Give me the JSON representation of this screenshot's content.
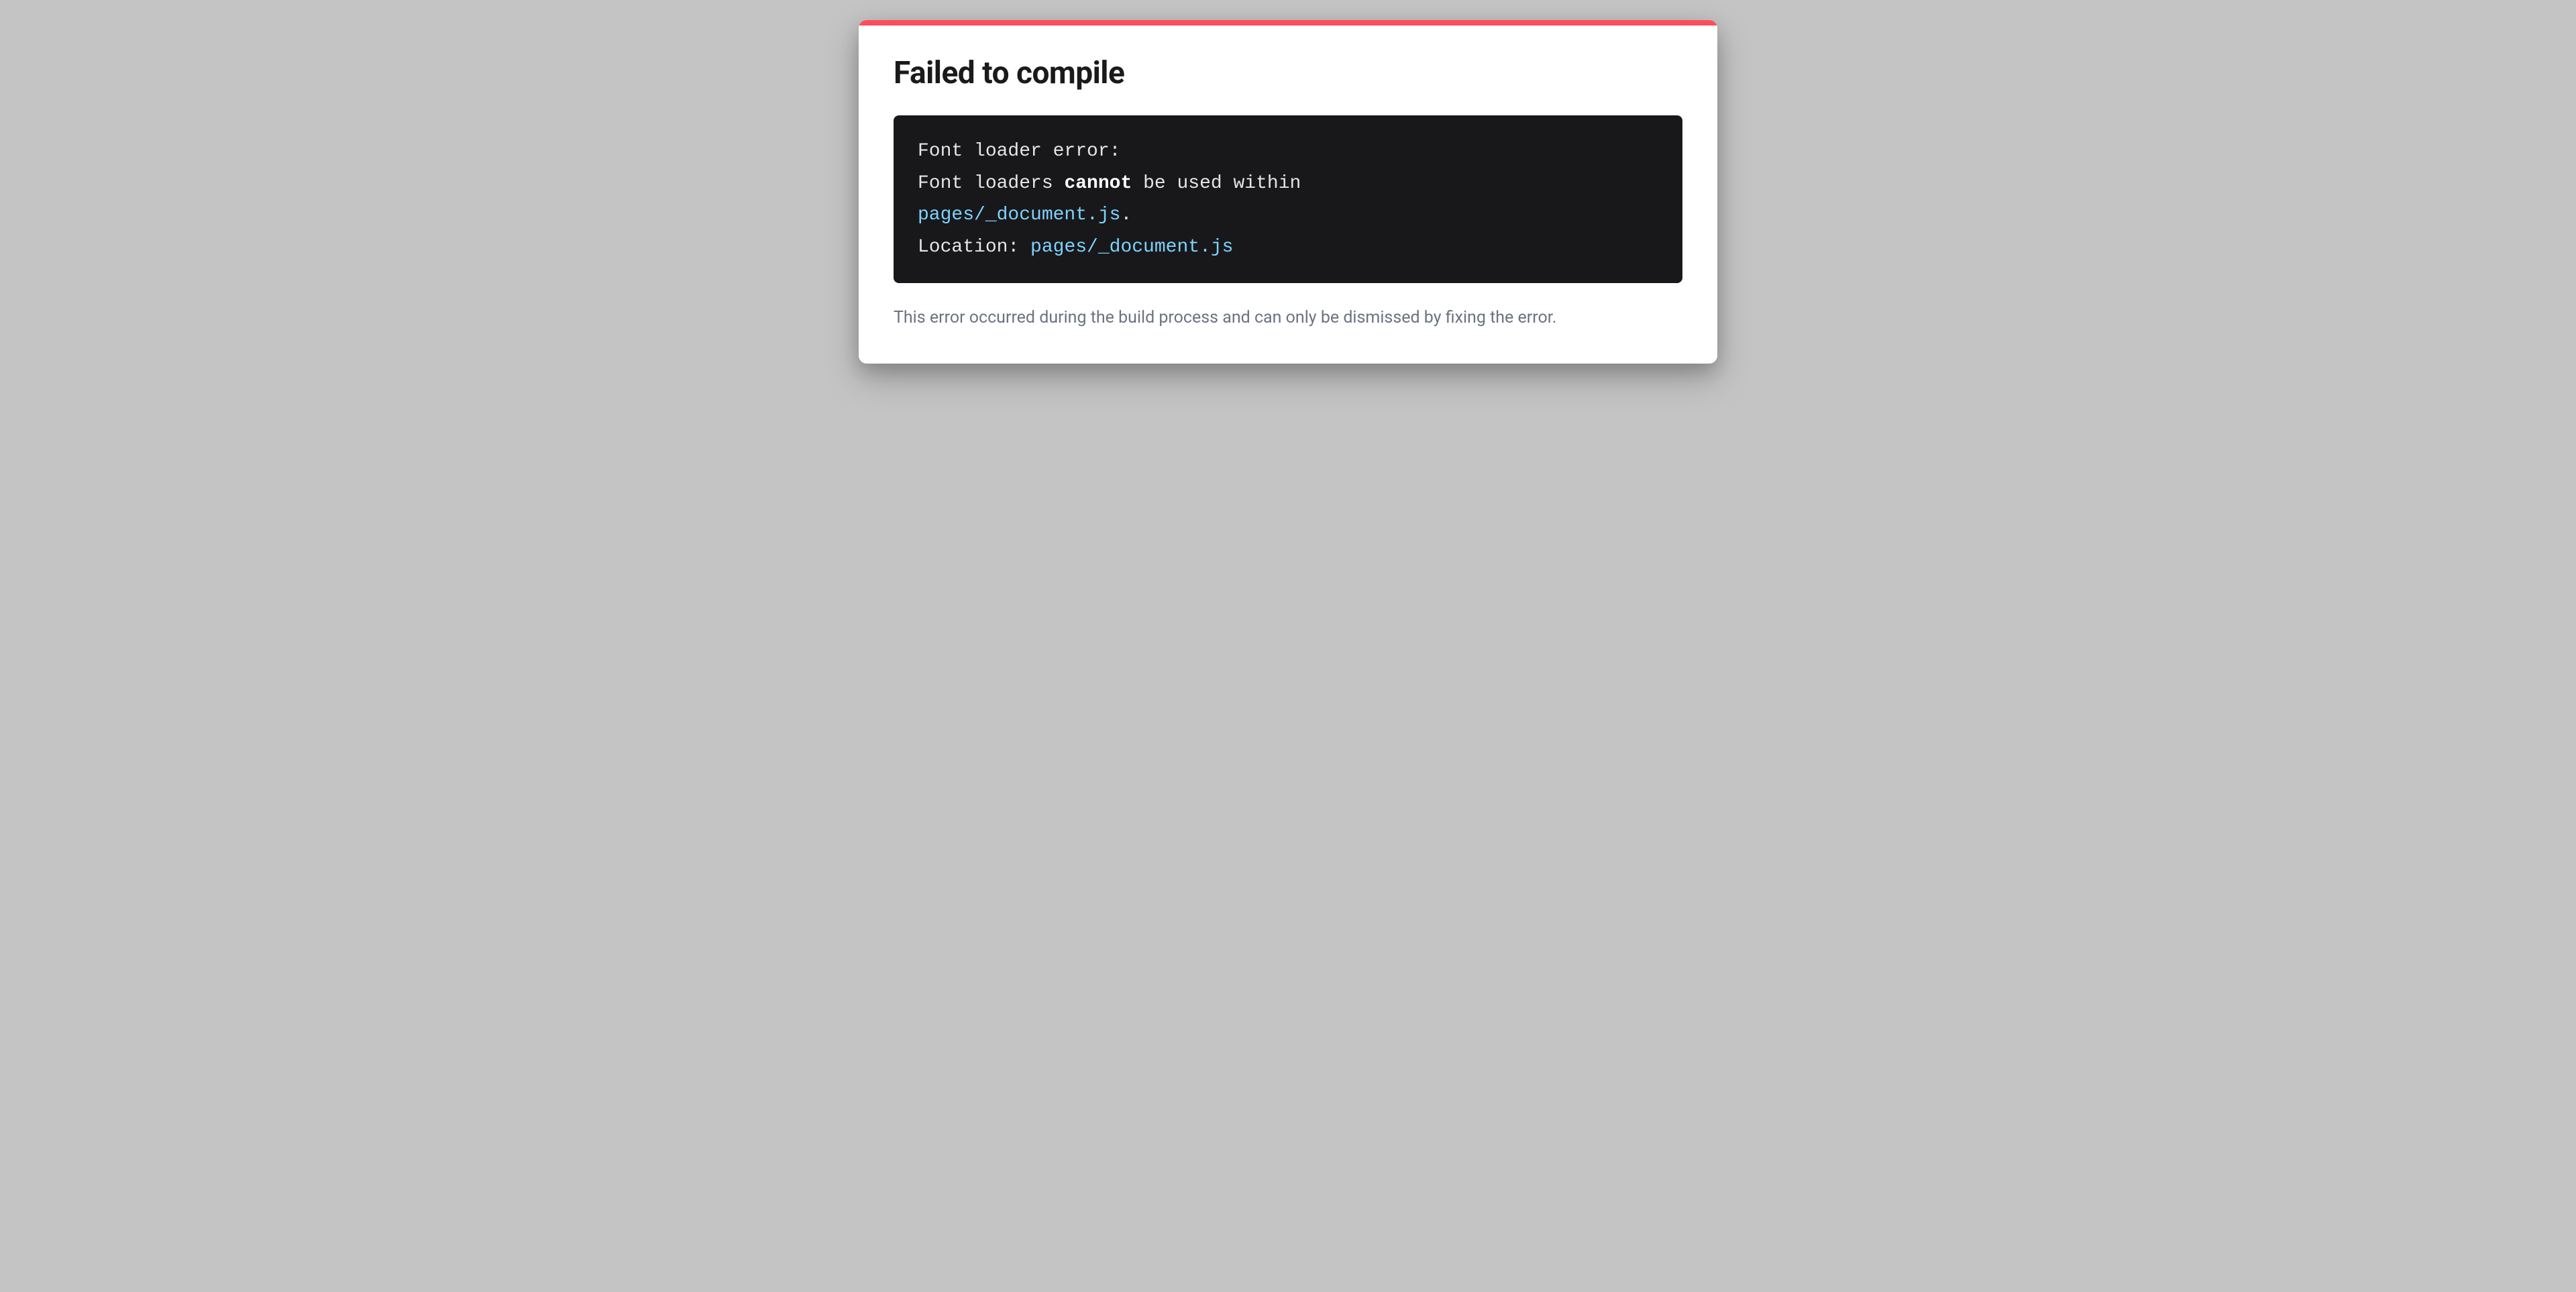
{
  "error": {
    "title": "Failed to compile",
    "code": {
      "line1": "Font loader error:",
      "line2_prefix": "Font loaders ",
      "line2_bold": "cannot",
      "line2_suffix": " be used within",
      "line3_path": "pages/_document.js",
      "line3_suffix": ".",
      "line4_prefix": "Location: ",
      "line4_path": "pages/_document.js"
    },
    "footer": "This error occurred during the build process and can only be dismissed by fixing the error."
  }
}
